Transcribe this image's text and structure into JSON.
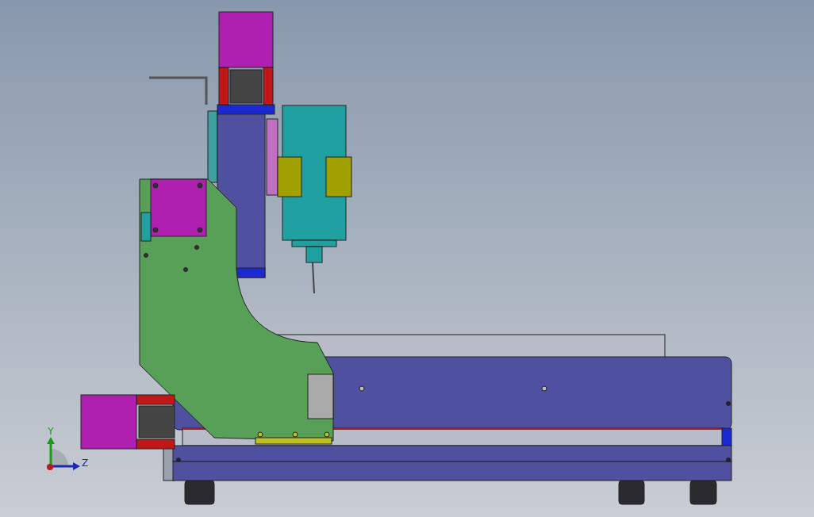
{
  "viewport": {
    "triad": {
      "labels": [
        "Y",
        "Z"
      ]
    }
  }
}
